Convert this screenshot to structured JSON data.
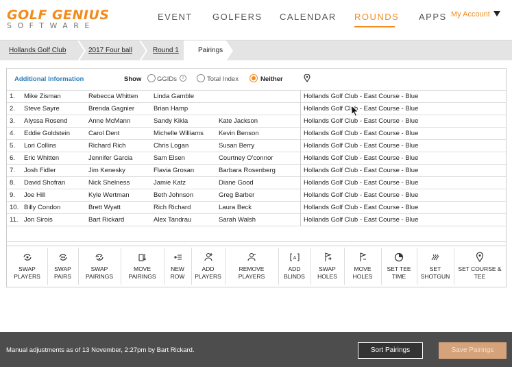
{
  "logo": {
    "line1": "GOLF GENIUS",
    "line2": "SOFTWARE"
  },
  "nav": {
    "items": [
      "EVENT",
      "GOLFERS",
      "CALENDAR",
      "ROUNDS",
      "APPS"
    ],
    "active": "ROUNDS",
    "account": "My Account"
  },
  "breadcrumb": [
    "Hollands Golf Club",
    "2017 Four ball",
    "Round 1",
    "Pairings"
  ],
  "options": {
    "section_label": "Additional Information",
    "show_label": "Show",
    "radio": [
      "GGIDs",
      "Total Index",
      "Neither"
    ],
    "selected": "Neither"
  },
  "pairings": [
    {
      "num": "1.",
      "players": [
        "Mike Zisman",
        "Rebecca Whitten",
        "Linda Gamble",
        ""
      ],
      "course": "Hollands Golf Club - East Course - Blue"
    },
    {
      "num": "2.",
      "players": [
        "Steve Sayre",
        "Brenda Gagnier",
        "Brian Hamp",
        ""
      ],
      "course": "Hollands Golf Club - East Course - Blue"
    },
    {
      "num": "3.",
      "players": [
        "Alyssa Rosend",
        "Anne McMann",
        "Sandy Kikla",
        "Kate Jackson"
      ],
      "course": "Hollands Golf Club - East Course - Blue"
    },
    {
      "num": "4.",
      "players": [
        "Eddie Goldstein",
        "Carol Dent",
        "Michelle Williams",
        "Kevin Benson"
      ],
      "course": "Hollands Golf Club - East Course - Blue"
    },
    {
      "num": "5.",
      "players": [
        "Lori Collins",
        "Richard Rich",
        "Chris Logan",
        "Susan Berry"
      ],
      "course": "Hollands Golf Club - East Course - Blue"
    },
    {
      "num": "6.",
      "players": [
        "Eric Whitten",
        "Jennifer Garcia",
        "Sam Elsen",
        "Courtney O'connor"
      ],
      "course": "Hollands Golf Club - East Course - Blue"
    },
    {
      "num": "7.",
      "players": [
        "Josh Fidler",
        "Jim Kenesky",
        "Flavia Grosan",
        "Barbara Rosenberg"
      ],
      "course": "Hollands Golf Club - East Course - Blue"
    },
    {
      "num": "8.",
      "players": [
        "David Shofran",
        "Nick Shelness",
        "Jamie Katz",
        "Diane Good"
      ],
      "course": "Hollands Golf Club - East Course - Blue"
    },
    {
      "num": "9.",
      "players": [
        "Joe Hill",
        "Kyle Wertman",
        "Beth Johnson",
        "Greg Barber"
      ],
      "course": "Hollands Golf Club - East Course - Blue"
    },
    {
      "num": "10.",
      "players": [
        "Billy Condon",
        "Brett Wyatt",
        "Rich Richard",
        "Laura Beck"
      ],
      "course": "Hollands Golf Club - East Course - Blue"
    },
    {
      "num": "11.",
      "players": [
        "Jon Sirois",
        "Bart Rickard",
        "Alex Tandrau",
        "Sarah Walsh"
      ],
      "course": "Hollands Golf Club - East Course - Blue"
    }
  ],
  "toolbar": [
    {
      "label1": "SWAP",
      "label2": "PLAYERS",
      "icon": "swap-players-icon"
    },
    {
      "label1": "SWAP",
      "label2": "PAIRS",
      "icon": "swap-pairs-icon"
    },
    {
      "label1": "SWAP",
      "label2": "PAIRINGS",
      "icon": "swap-pairings-icon"
    },
    {
      "label1": "MOVE",
      "label2": "PAIRINGS",
      "icon": "move-pairings-icon"
    },
    {
      "label1": "NEW",
      "label2": "ROW",
      "icon": "new-row-icon"
    },
    {
      "label1": "ADD",
      "label2": "PLAYERS",
      "icon": "add-player-icon"
    },
    {
      "label1": "REMOVE",
      "label2": "PLAYERS",
      "icon": "remove-player-icon"
    },
    {
      "label1": "ADD",
      "label2": "BLINDS",
      "icon": "add-blinds-icon"
    },
    {
      "label1": "SWAP",
      "label2": "HOLES",
      "icon": "swap-holes-icon"
    },
    {
      "label1": "MOVE",
      "label2": "HOLES",
      "icon": "move-holes-icon"
    },
    {
      "label1": "SET TEE",
      "label2": "TIME",
      "icon": "clock-icon"
    },
    {
      "label1": "SET",
      "label2": "SHOTGUN",
      "icon": "shotgun-icon"
    },
    {
      "label1": "SET COURSE &",
      "label2": "TEE",
      "icon": "map-pin-icon"
    }
  ],
  "footer": {
    "message": "Manual adjustments as of 13 November, 2:27pm by Bart Rickard.",
    "sort_label": "Sort Pairings",
    "save_label": "Save Pairings"
  },
  "colors": {
    "accent": "#f28b1c",
    "link": "#2e7db8",
    "footer_bg": "#4d4d4d"
  }
}
